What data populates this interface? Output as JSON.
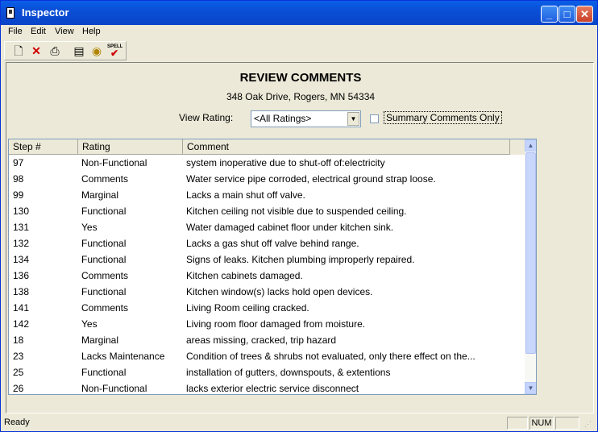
{
  "window": {
    "title": "Inspector"
  },
  "menu": [
    "File",
    "Edit",
    "View",
    "Help"
  ],
  "toolbar": {
    "spell_label": "SPELL"
  },
  "review": {
    "heading": "REVIEW COMMENTS",
    "address": "348 Oak Drive, Rogers, MN 54334",
    "rating_label": "View Rating:",
    "rating_value": "<All Ratings>",
    "summary_label": "Summary Comments Only"
  },
  "table": {
    "columns": [
      "Step #",
      "Rating",
      "Comment"
    ],
    "rows": [
      {
        "step": "97",
        "rating": "Non-Functional",
        "comment": "system inoperative due to shut-off of:electricity"
      },
      {
        "step": "98",
        "rating": "Comments",
        "comment": "Water service pipe corroded, electrical ground  strap loose."
      },
      {
        "step": "99",
        "rating": "Marginal",
        "comment": "Lacks a main shut off valve."
      },
      {
        "step": "130",
        "rating": "Functional",
        "comment": "Kitchen ceiling not visible due to suspended ceiling."
      },
      {
        "step": "131",
        "rating": "Yes",
        "comment": "Water damaged cabinet floor under kitchen sink."
      },
      {
        "step": "132",
        "rating": "Functional",
        "comment": "Lacks a gas shut off valve behind range."
      },
      {
        "step": "134",
        "rating": "Functional",
        "comment": "Signs of leaks. Kitchen plumbing improperly repaired."
      },
      {
        "step": "136",
        "rating": "Comments",
        "comment": "Kitchen  cabinets damaged."
      },
      {
        "step": "138",
        "rating": "Functional",
        "comment": "Kitchen window(s) lacks hold open devices."
      },
      {
        "step": "141",
        "rating": "Comments",
        "comment": "Living Room ceiling cracked."
      },
      {
        "step": "142",
        "rating": "Yes",
        "comment": "Living room floor damaged from moisture."
      },
      {
        "step": "18",
        "rating": "Marginal",
        "comment": "areas missing, cracked, trip hazard"
      },
      {
        "step": "23",
        "rating": "Lacks Maintenance",
        "comment": "Condition of trees & shrubs not evaluated, only there effect on the..."
      },
      {
        "step": "25",
        "rating": "Functional",
        "comment": "installation of gutters, downspouts, & extentions"
      },
      {
        "step": "26",
        "rating": "Non-Functional",
        "comment": "lacks exterior electric service disconnect"
      }
    ]
  },
  "status": {
    "text": "Ready",
    "num": "NUM"
  }
}
